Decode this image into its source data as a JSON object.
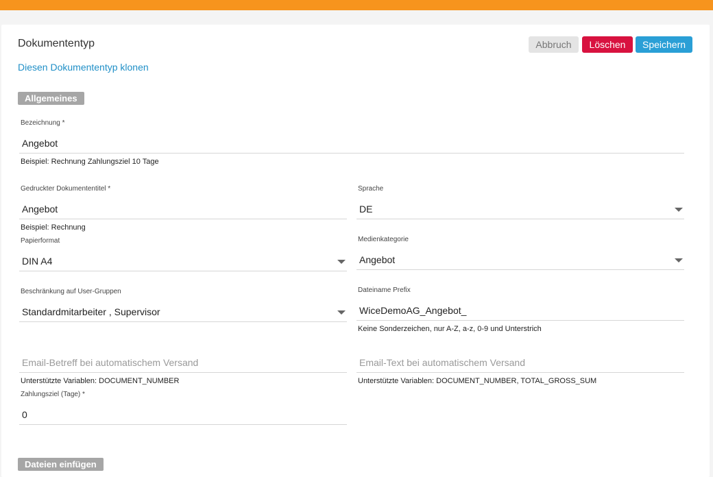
{
  "page": {
    "title": "Dokumententyp",
    "clone_link": "Diesen Dokumententyp klonen"
  },
  "buttons": {
    "cancel": "Abbruch",
    "delete": "Löschen",
    "save": "Speichern"
  },
  "sections": {
    "general": "Allgemeines",
    "files": "Dateien einfügen"
  },
  "fields": {
    "bezeichnung": {
      "label": "Bezeichnung *",
      "value": "Angebot",
      "hint": "Beispiel: Rechnung Zahlungsziel 10 Tage"
    },
    "printed_title": {
      "label": "Gedruckter Dokumententitel *",
      "value": "Angebot",
      "hint": "Beispiel: Rechnung"
    },
    "sprache": {
      "label": "Sprache",
      "value": "DE"
    },
    "papierformat": {
      "label": "Papierformat",
      "value": "DIN A4"
    },
    "medienkategorie": {
      "label": "Medienkategorie",
      "value": "Angebot"
    },
    "user_groups": {
      "label": "Beschränkung auf User-Gruppen",
      "value": "Standardmitarbeiter , Supervisor"
    },
    "dateiname_prefix": {
      "label": "Dateiname Prefix",
      "value": "WiceDemoAG_Angebot_",
      "hint": "Keine Sonderzeichen, nur A-Z, a-z, 0-9 und Unterstrich"
    },
    "email_subject": {
      "placeholder": "Email-Betreff bei automatischem Versand",
      "hint": "Unterstützte Variablen: DOCUMENT_NUMBER"
    },
    "email_text": {
      "placeholder": "Email-Text bei automatischem Versand",
      "hint": "Unterstützte Variablen: DOCUMENT_NUMBER, TOTAL_GROSS_SUM"
    },
    "zahlungsziel": {
      "label": "Zahlungsziel (Tage) *",
      "value": "0"
    }
  },
  "colors": {
    "topbar": "#f7941d",
    "link": "#1f8fc7",
    "delete": "#d8123f",
    "save": "#2a9fd6"
  }
}
